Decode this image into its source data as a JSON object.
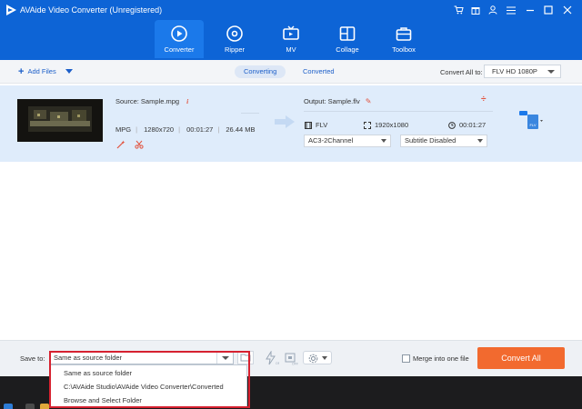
{
  "window": {
    "title": "AVAide Video Converter (Unregistered)",
    "controls": [
      "cart-icon",
      "gift-icon",
      "user-icon",
      "menu-icon",
      "minimize-icon",
      "maximize-icon",
      "close-icon"
    ]
  },
  "nav": [
    {
      "label": "Converter",
      "icon": "converter-icon",
      "active": true
    },
    {
      "label": "Ripper",
      "icon": "disc-icon",
      "active": false
    },
    {
      "label": "MV",
      "icon": "tv-icon",
      "active": false
    },
    {
      "label": "Collage",
      "icon": "collage-icon",
      "active": false
    },
    {
      "label": "Toolbox",
      "icon": "toolbox-icon",
      "active": false
    }
  ],
  "toolbar": {
    "add_files": "Add Files",
    "tabs": [
      "Converting",
      "Converted"
    ],
    "active_tab": "Converting",
    "convert_all_label": "Convert All to:",
    "convert_all_format": "FLV HD 1080P"
  },
  "file": {
    "source": "Source: Sample.mpg",
    "format": "MPG",
    "resolution": "1280x720",
    "duration": "00:01:27",
    "size": "26.44 MB",
    "output": "Output: Sample.flv",
    "out_format": "FLV",
    "out_resolution": "1920x1080",
    "out_duration": "00:01:27",
    "audio": "AC3-2Channel",
    "subtitle": "Subtitle Disabled",
    "format_badge": "FLV"
  },
  "bottom": {
    "save_to_label": "Save to:",
    "save_to_value": "Same as source folder",
    "merge_label": "Merge into one file",
    "convert_button": "Convert All"
  },
  "save_dropdown": {
    "options": [
      "Same as source folder",
      "C:\\AVAide Studio\\AVAide Video Converter\\Converted",
      "Browse and Select Folder"
    ]
  },
  "colors": {
    "header": "#0d64d6",
    "accent": "#f26a2f",
    "highlight_box": "#d6212f"
  }
}
